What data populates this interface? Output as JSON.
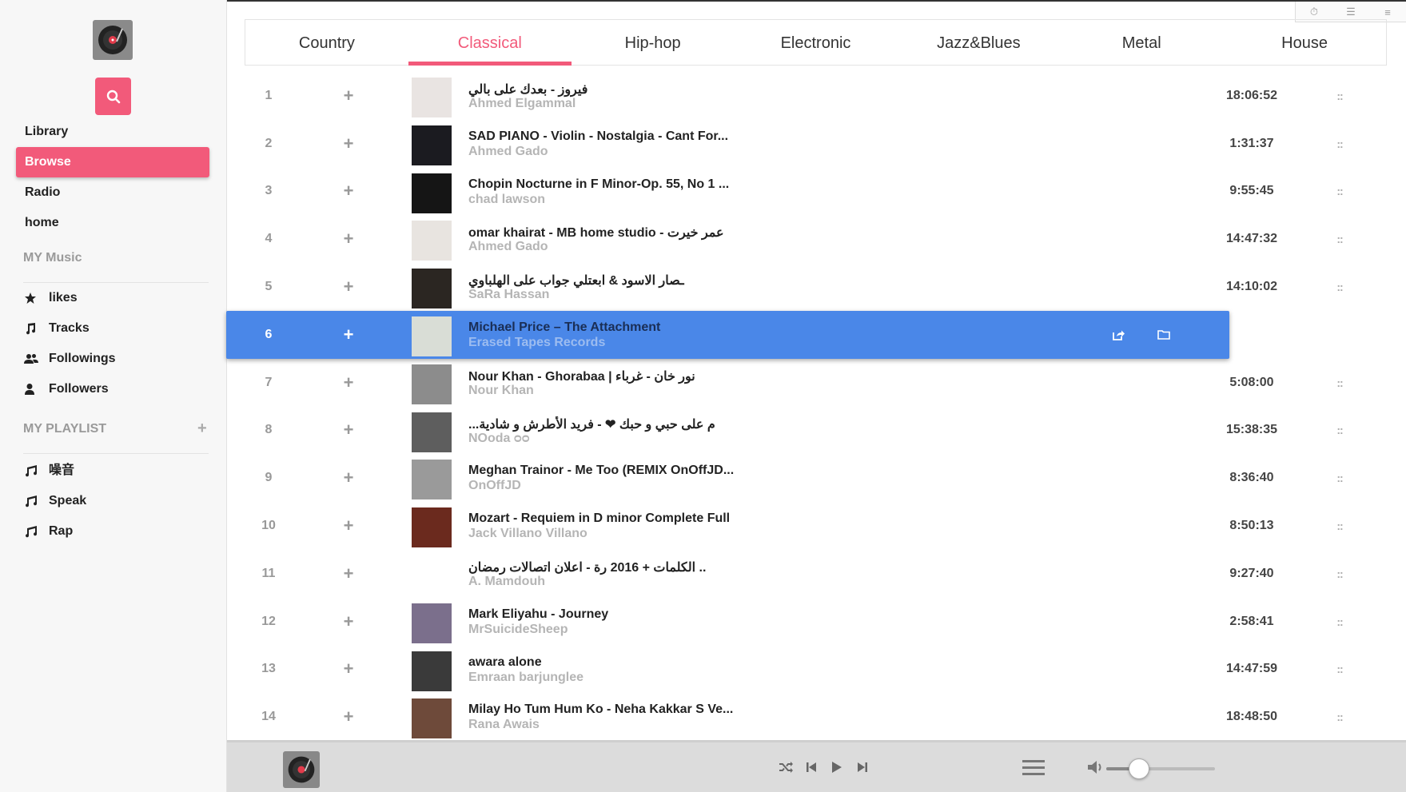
{
  "window_controls": [
    "timer-icon",
    "list-icon",
    "menu-icon"
  ],
  "sidebar": {
    "nav": [
      {
        "label": "Library",
        "active": false
      },
      {
        "label": "Browse",
        "active": true
      },
      {
        "label": "Radio",
        "active": false
      },
      {
        "label": "home",
        "active": false
      }
    ],
    "my_music_title": "MY Music",
    "my_music": [
      {
        "label": "likes",
        "icon": "star-icon"
      },
      {
        "label": "Tracks",
        "icon": "music-note-icon"
      },
      {
        "label": "Followings",
        "icon": "users-icon"
      },
      {
        "label": "Followers",
        "icon": "user-icon"
      }
    ],
    "playlist_title": "MY PLAYLIST",
    "playlist_add": "+",
    "playlists": [
      {
        "label": "噪音",
        "icon": "music-notes-icon"
      },
      {
        "label": "Speak",
        "icon": "music-notes-icon"
      },
      {
        "label": "Rap",
        "icon": "music-notes-icon"
      }
    ]
  },
  "tabs": [
    {
      "label": "Country",
      "active": false
    },
    {
      "label": "Classical",
      "active": true
    },
    {
      "label": "Hip-hop",
      "active": false
    },
    {
      "label": "Electronic",
      "active": false
    },
    {
      "label": "Jazz&Blues",
      "active": false
    },
    {
      "label": "Metal",
      "active": false
    },
    {
      "label": "House",
      "active": false
    }
  ],
  "tracks": [
    {
      "num": "1",
      "title": "فيروز - بعدك على بالي",
      "artist": "Ahmed Elgammal",
      "duration": "18:06:52",
      "cover": "#e9e4e2",
      "rtl": true
    },
    {
      "num": "2",
      "title": "SAD PIANO - Violin - Nostalgia - Cant For...",
      "artist": "Ahmed Gado",
      "duration": "1:31:37",
      "cover": "#1b1b20"
    },
    {
      "num": "3",
      "title": "Chopin Nocturne in F Minor-Op. 55, No 1 ...",
      "artist": "chad lawson",
      "duration": "9:55:45",
      "cover": "#151515"
    },
    {
      "num": "4",
      "title": "omar khairat - MB home studio - عمر خيرت",
      "artist": "Ahmed Gado",
      "duration": "14:47:32",
      "cover": "#e8e4e0"
    },
    {
      "num": "5",
      "title": "ـصار الاسود & ابعتلي جواب على الهلباوي",
      "artist": "SaRa Hassan",
      "duration": "14:10:02",
      "cover": "#2b2622",
      "rtl": true
    },
    {
      "num": "6",
      "title": "Michael Price – The Attachment",
      "artist": "Erased Tapes Records",
      "duration": "",
      "cover": "#d9ddd6",
      "selected": true
    },
    {
      "num": "7",
      "title": "Nour Khan - Ghorabaa | نور خان - غرباء",
      "artist": "Nour Khan",
      "duration": "5:08:00",
      "cover": "#8c8c8c"
    },
    {
      "num": "8",
      "title": "...م على حبي و حبك ❤ - فريد الأطرش و شادية",
      "artist": "NOoda ᴑᴑ",
      "duration": "15:38:35",
      "cover": "#5e5e5e",
      "rtl": true
    },
    {
      "num": "9",
      "title": "Meghan Trainor - Me Too (REMIX OnOffJD...",
      "artist": "OnOffJD",
      "duration": "8:36:40",
      "cover": "#9a9a9a"
    },
    {
      "num": "10",
      "title": "Mozart - Requiem in D minor Complete Full",
      "artist": "Jack Villano Villano",
      "duration": "8:50:13",
      "cover": "#6b2a1e"
    },
    {
      "num": "11",
      "title": "الكلمات + 2016 رة - اعلان اتصالات رمضان ..",
      "artist": "A. Mamdouh",
      "duration": "9:27:40",
      "cover": "#ffffff",
      "rtl": true
    },
    {
      "num": "12",
      "title": "Mark Eliyahu - Journey",
      "artist": "MrSuicideSheep",
      "duration": "2:58:41",
      "cover": "#7b6f8c"
    },
    {
      "num": "13",
      "title": "awara alone",
      "artist": "Emraan barjunglee",
      "duration": "14:47:59",
      "cover": "#3a3a3a"
    },
    {
      "num": "14",
      "title": "Milay Ho Tum Hum Ko - Neha Kakkar S Ve...",
      "artist": "Rana Awais",
      "duration": "18:48:50",
      "cover": "#6e4a3a"
    }
  ],
  "colors": {
    "accent": "#f25a7a",
    "selected_row": "#4a87e8"
  },
  "player": {
    "volume": 0.3
  }
}
